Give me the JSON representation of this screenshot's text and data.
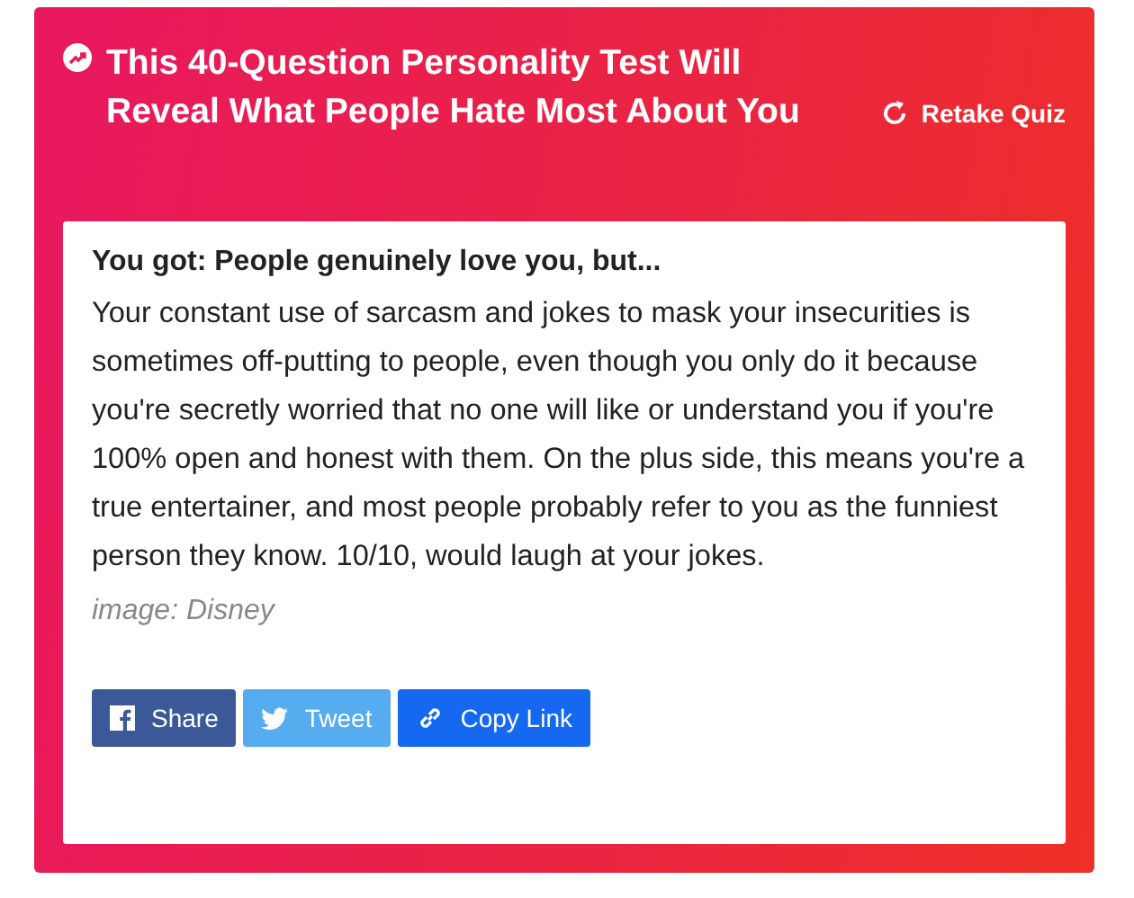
{
  "quiz": {
    "title": "This 40-Question Personality Test Will Reveal What People Hate Most About You",
    "retake": "Retake Quiz"
  },
  "result": {
    "heading": "You got: People genuinely love you, but...",
    "body": "Your constant use of sarcasm and jokes to mask your insecurities is sometimes off-putting to people, even though you only do it because you're secretly worried that no one will like or understand you if you're 100% open and honest with them. On the plus side, this means you're a true entertainer, and most people probably refer to you as the funniest person they know. 10/10, would laugh at your jokes.",
    "credit": "image: Disney"
  },
  "share_buttons": [
    {
      "kind": "facebook",
      "label": "Share"
    },
    {
      "kind": "twitter",
      "label": "Tweet"
    },
    {
      "kind": "link",
      "label": "Copy Link"
    }
  ]
}
